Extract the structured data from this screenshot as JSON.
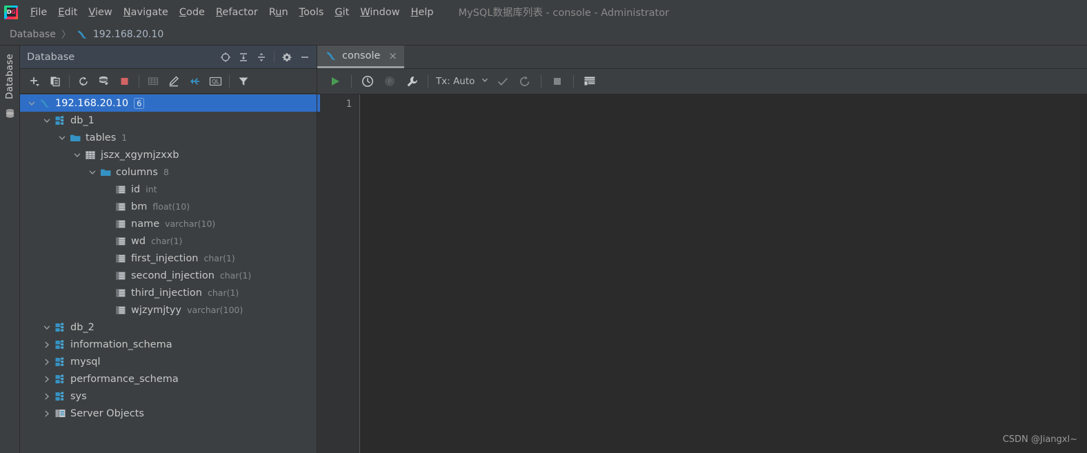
{
  "window": {
    "title": "MySQL数据库列表 - console - Administrator",
    "app_icon": "datagrip-icon"
  },
  "menubar": {
    "items": [
      {
        "label": "File",
        "mnemonic": "F",
        "rest": "ile"
      },
      {
        "label": "Edit",
        "mnemonic": "E",
        "rest": "dit"
      },
      {
        "label": "View",
        "mnemonic": "V",
        "rest": "iew"
      },
      {
        "label": "Navigate",
        "mnemonic": "N",
        "rest": "avigate"
      },
      {
        "label": "Code",
        "mnemonic": "C",
        "rest": "ode"
      },
      {
        "label": "Refactor",
        "mnemonic": "R",
        "rest": "efactor"
      },
      {
        "label": "Run",
        "mnemonic": "u",
        "pre": "R",
        "rest": "n"
      },
      {
        "label": "Tools",
        "mnemonic": "T",
        "rest": "ools"
      },
      {
        "label": "Git",
        "mnemonic": "G",
        "rest": "it"
      },
      {
        "label": "Window",
        "mnemonic": "W",
        "rest": "indow"
      },
      {
        "label": "Help",
        "mnemonic": "H",
        "rest": "elp"
      }
    ]
  },
  "breadcrumb": {
    "root": "Database",
    "separator": "〉",
    "host": "192.168.20.10"
  },
  "left_strip": {
    "tool_label": "Database",
    "database_icon": "database-cylinder-icon"
  },
  "db_panel": {
    "header_title": "Database",
    "header_icons": [
      "locate-target-icon",
      "expand-all-icon",
      "collapse-all-icon",
      "settings-gear-icon",
      "hide-minimize-icon"
    ],
    "toolbar_icons": [
      "add-new-icon",
      "duplicate-icon",
      "refresh-icon",
      "sync-datasource-icon",
      "stop-icon",
      "data-editor-icon",
      "edit-icon",
      "jump-to-icon",
      "query-console-icon",
      "filter-icon"
    ],
    "query_console_icon_label": "QL"
  },
  "tree": [
    {
      "id": "host",
      "label": "192.168.20.10",
      "indent": 0,
      "chevron": "down",
      "icon": "mysql-dolphin-icon",
      "selected": true,
      "badge": "6",
      "meta": ""
    },
    {
      "id": "db_1",
      "label": "db_1",
      "indent": 1,
      "chevron": "down",
      "icon": "schema-icon",
      "selected": false,
      "badge": "",
      "meta": ""
    },
    {
      "id": "tables",
      "label": "tables",
      "indent": 2,
      "chevron": "down",
      "icon": "folder-icon",
      "selected": false,
      "badge": "",
      "meta": "1"
    },
    {
      "id": "jszx_xgymjzxxb",
      "label": "jszx_xgymjzxxb",
      "indent": 3,
      "chevron": "down",
      "icon": "table-icon",
      "selected": false,
      "badge": "",
      "meta": ""
    },
    {
      "id": "columns",
      "label": "columns",
      "indent": 4,
      "chevron": "down",
      "icon": "folder-icon",
      "selected": false,
      "badge": "",
      "meta": "8"
    },
    {
      "id": "col_id",
      "label": "id",
      "indent": 5,
      "chevron": "none",
      "icon": "column-icon",
      "selected": false,
      "badge": "",
      "meta": "int"
    },
    {
      "id": "col_bm",
      "label": "bm",
      "indent": 5,
      "chevron": "none",
      "icon": "column-icon",
      "selected": false,
      "badge": "",
      "meta": "float(10)"
    },
    {
      "id": "col_name",
      "label": "name",
      "indent": 5,
      "chevron": "none",
      "icon": "column-icon",
      "selected": false,
      "badge": "",
      "meta": "varchar(10)"
    },
    {
      "id": "col_wd",
      "label": "wd",
      "indent": 5,
      "chevron": "none",
      "icon": "column-icon",
      "selected": false,
      "badge": "",
      "meta": "char(1)"
    },
    {
      "id": "col_first_injection",
      "label": "first_injection",
      "indent": 5,
      "chevron": "none",
      "icon": "column-icon",
      "selected": false,
      "badge": "",
      "meta": "char(1)"
    },
    {
      "id": "col_second_injection",
      "label": "second_injection",
      "indent": 5,
      "chevron": "none",
      "icon": "column-icon",
      "selected": false,
      "badge": "",
      "meta": "char(1)"
    },
    {
      "id": "col_third_injection",
      "label": "third_injection",
      "indent": 5,
      "chevron": "none",
      "icon": "column-icon",
      "selected": false,
      "badge": "",
      "meta": "char(1)"
    },
    {
      "id": "col_wjzymjtyy",
      "label": "wjzymjtyy",
      "indent": 5,
      "chevron": "none",
      "icon": "column-icon",
      "selected": false,
      "badge": "",
      "meta": "varchar(100)"
    },
    {
      "id": "db_2",
      "label": "db_2",
      "indent": 1,
      "chevron": "down",
      "icon": "schema-icon",
      "selected": false,
      "badge": "",
      "meta": ""
    },
    {
      "id": "information_schema",
      "label": "information_schema",
      "indent": 1,
      "chevron": "right",
      "icon": "schema-icon",
      "selected": false,
      "badge": "",
      "meta": ""
    },
    {
      "id": "mysql",
      "label": "mysql",
      "indent": 1,
      "chevron": "right",
      "icon": "schema-icon",
      "selected": false,
      "badge": "",
      "meta": ""
    },
    {
      "id": "performance_schema",
      "label": "performance_schema",
      "indent": 1,
      "chevron": "right",
      "icon": "schema-icon",
      "selected": false,
      "badge": "",
      "meta": ""
    },
    {
      "id": "sys",
      "label": "sys",
      "indent": 1,
      "chevron": "right",
      "icon": "schema-icon",
      "selected": false,
      "badge": "",
      "meta": ""
    },
    {
      "id": "server_objects",
      "label": "Server Objects",
      "indent": 1,
      "chevron": "right",
      "icon": "server-objects-icon",
      "selected": false,
      "badge": "",
      "meta": ""
    }
  ],
  "editor": {
    "tab": {
      "label": "console",
      "icon": "mysql-dolphin-icon",
      "close": "×"
    },
    "toolbar": {
      "run_label": "run-icon",
      "history_label": "history-icon",
      "profile_label": "profile-icon",
      "settings_label": "wrench-icon",
      "tx_label": "Tx: Auto",
      "commit_label": "commit-check-icon",
      "rollback_label": "rollback-icon",
      "stop_label": "stop-icon",
      "output_label": "output-table-icon"
    },
    "line_numbers": [
      "1"
    ],
    "content_lines": [
      ""
    ]
  },
  "watermark": "CSDN @Jiangxl~",
  "colors": {
    "background": "#3c3f41",
    "editor_background": "#2b2b2b",
    "selection_blue": "#2f6ec6",
    "panel_header": "#3c4450",
    "accent_cyan": "#3592c4",
    "run_green": "#499c54",
    "stop_red": "#d46363",
    "text": "#bbbbbb"
  }
}
